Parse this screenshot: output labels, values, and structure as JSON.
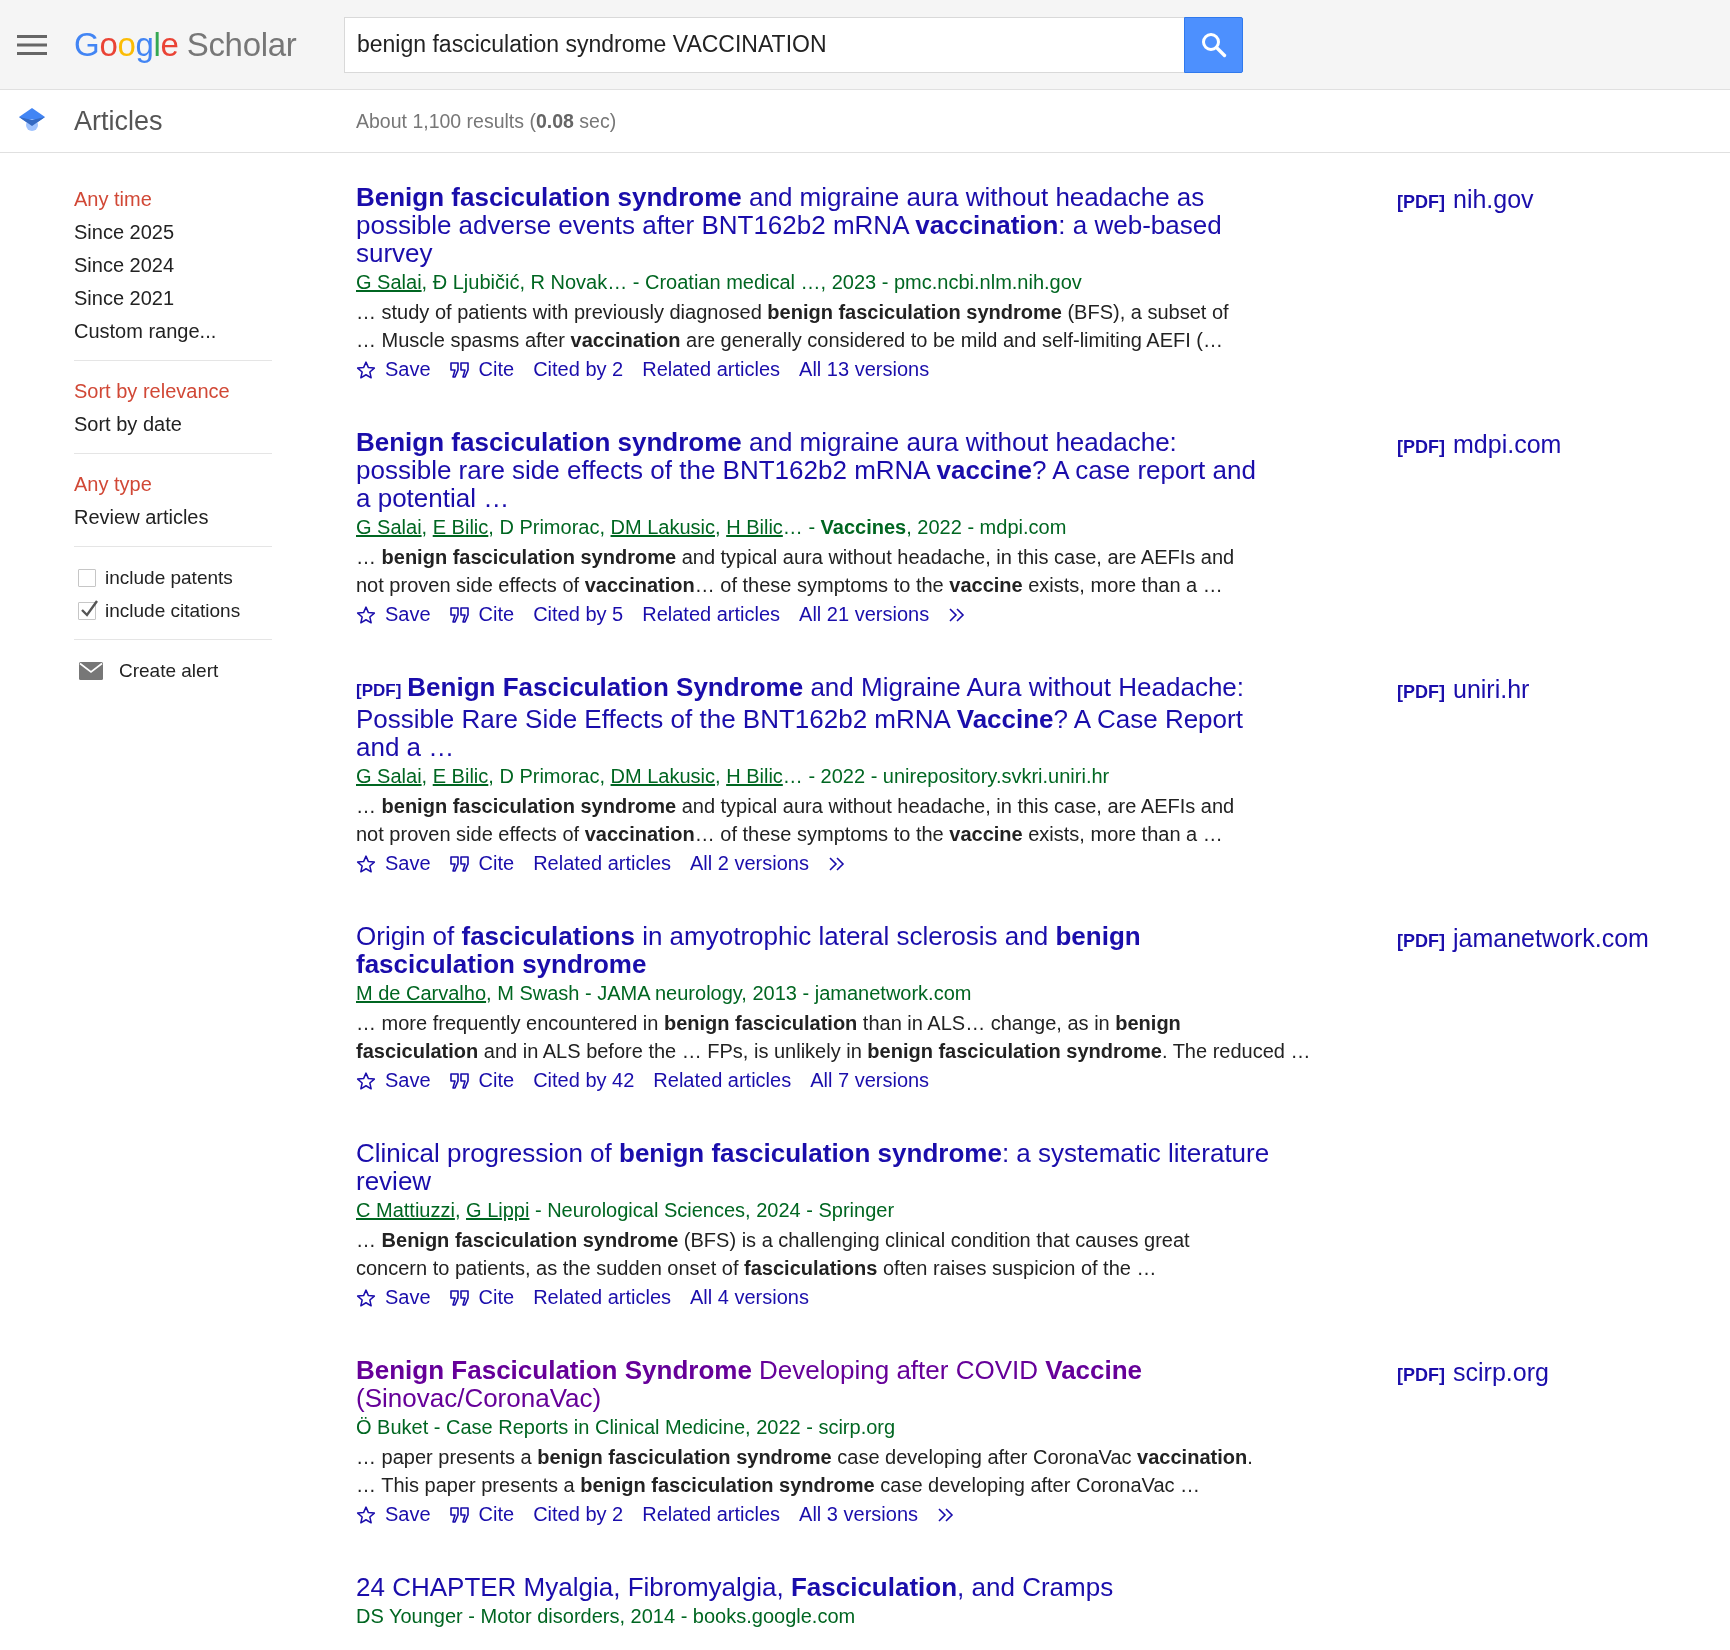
{
  "header": {
    "logo": {
      "brand": "Google",
      "product": "Scholar"
    },
    "search": {
      "value": "benign fasciculation syndrome VACCINATION"
    }
  },
  "subheader": {
    "section": "Articles",
    "stats": "About 1,100 results (**0.08** sec)"
  },
  "sidebar": {
    "time_filters": [
      {
        "label": "Any time",
        "selected": true
      },
      {
        "label": "Since 2025",
        "selected": false
      },
      {
        "label": "Since 2024",
        "selected": false
      },
      {
        "label": "Since 2021",
        "selected": false
      },
      {
        "label": "Custom range...",
        "selected": false
      }
    ],
    "sort_options": [
      {
        "label": "Sort by relevance",
        "selected": true
      },
      {
        "label": "Sort by date",
        "selected": false
      }
    ],
    "type_filters": [
      {
        "label": "Any type",
        "selected": true
      },
      {
        "label": "Review articles",
        "selected": false
      }
    ],
    "checkboxes": [
      {
        "label": "include patents",
        "checked": false
      },
      {
        "label": "include citations",
        "checked": true
      }
    ],
    "alert": "Create alert"
  },
  "results": [
    {
      "title": "**Benign fasciculation syndrome** and migraine aura without headache as possible adverse events after BNT162b2 mRNA **vaccination**: a web-based survey",
      "visited": false,
      "byline": [
        {
          "text": "G Salai",
          "linked": true
        },
        {
          "text": ", Đ Ljubičić, R Novak… - Croatian medical …, 2023 - pmc.ncbi.nlm.nih.gov",
          "linked": false
        }
      ],
      "snippet_lines": [
        "… study of patients with previously diagnosed **benign fasciculation syndrome** (BFS), a subset of",
        "… Muscle spasms after **vaccination** are generally considered to be mild and self-limiting AEFI (…"
      ],
      "actions": [
        {
          "kind": "save",
          "label": "Save"
        },
        {
          "kind": "cite",
          "label": "Cite"
        },
        {
          "kind": "link",
          "label": "Cited by 2"
        },
        {
          "kind": "link",
          "label": "Related articles"
        },
        {
          "kind": "link",
          "label": "All 13 versions"
        }
      ],
      "more": false,
      "side_link": {
        "tag": "[PDF]",
        "domain": "nih.gov"
      }
    },
    {
      "title": "**Benign fasciculation syndrome** and migraine aura without headache: possible rare side effects of the BNT162b2 mRNA **vaccine**? A case report and a potential …",
      "visited": false,
      "byline": [
        {
          "text": "G Salai",
          "linked": true
        },
        {
          "text": ", ",
          "linked": false
        },
        {
          "text": "E Bilic",
          "linked": true
        },
        {
          "text": ", D Primorac, ",
          "linked": false
        },
        {
          "text": "DM Lakusic",
          "linked": true
        },
        {
          "text": ", ",
          "linked": false
        },
        {
          "text": "H Bilic",
          "linked": true
        },
        {
          "text": "… - **Vaccines**, 2022 - mdpi.com",
          "linked": false
        }
      ],
      "snippet_lines": [
        "… **benign fasciculation syndrome** and typical aura without headache, in this case, are AEFIs and",
        "not proven side effects of **vaccination**… of these symptoms to the **vaccine** exists, more than a …"
      ],
      "actions": [
        {
          "kind": "save",
          "label": "Save"
        },
        {
          "kind": "cite",
          "label": "Cite"
        },
        {
          "kind": "link",
          "label": "Cited by 5"
        },
        {
          "kind": "link",
          "label": "Related articles"
        },
        {
          "kind": "link",
          "label": "All 21 versions"
        }
      ],
      "more": true,
      "side_link": {
        "tag": "[PDF]",
        "domain": "mdpi.com"
      }
    },
    {
      "pdf_tag": "[PDF]",
      "title": "**Benign Fasciculation Syndrome** and Migraine Aura without Headache: Possible Rare Side Effects of the BNT162b2 mRNA **Vaccine**? A Case Report and a …",
      "visited": false,
      "byline": [
        {
          "text": "G Salai",
          "linked": true
        },
        {
          "text": ", ",
          "linked": false
        },
        {
          "text": "E Bilic",
          "linked": true
        },
        {
          "text": ", D Primorac, ",
          "linked": false
        },
        {
          "text": "DM Lakusic",
          "linked": true
        },
        {
          "text": ", ",
          "linked": false
        },
        {
          "text": "H Bilic",
          "linked": true
        },
        {
          "text": "… - 2022 - unirepository.svkri.uniri.hr",
          "linked": false
        }
      ],
      "snippet_lines": [
        "… **benign fasciculation syndrome** and typical aura without headache, in this case, are AEFIs and",
        "not proven side effects of **vaccination**… of these symptoms to the **vaccine** exists, more than a …"
      ],
      "actions": [
        {
          "kind": "save",
          "label": "Save"
        },
        {
          "kind": "cite",
          "label": "Cite"
        },
        {
          "kind": "link",
          "label": "Related articles"
        },
        {
          "kind": "link",
          "label": "All 2 versions"
        }
      ],
      "more": true,
      "side_link": {
        "tag": "[PDF]",
        "domain": "uniri.hr"
      }
    },
    {
      "title": "Origin of **fasciculations** in amyotrophic lateral sclerosis and **benign fasciculation syndrome**",
      "visited": false,
      "byline": [
        {
          "text": "M de Carvalho",
          "linked": true
        },
        {
          "text": ", M Swash - JAMA neurology, 2013 - jamanetwork.com",
          "linked": false
        }
      ],
      "snippet_lines": [
        "… more frequently encountered in **benign fasciculation** than in ALS… change, as in **benign**",
        "**fasciculation** and in ALS before the … FPs, is unlikely in **benign fasciculation syndrome**. The reduced …"
      ],
      "actions": [
        {
          "kind": "save",
          "label": "Save"
        },
        {
          "kind": "cite",
          "label": "Cite"
        },
        {
          "kind": "link",
          "label": "Cited by 42"
        },
        {
          "kind": "link",
          "label": "Related articles"
        },
        {
          "kind": "link",
          "label": "All 7 versions"
        }
      ],
      "more": false,
      "side_link": {
        "tag": "[PDF]",
        "domain": "jamanetwork.com"
      }
    },
    {
      "title": "Clinical progression of **benign fasciculation syndrome**: a systematic literature review",
      "visited": false,
      "byline": [
        {
          "text": "C Mattiuzzi",
          "linked": true
        },
        {
          "text": ", ",
          "linked": false
        },
        {
          "text": "G Lippi",
          "linked": true
        },
        {
          "text": " - Neurological Sciences, 2024 - Springer",
          "linked": false
        }
      ],
      "snippet_lines": [
        "… **Benign fasciculation syndrome** (BFS) is a challenging clinical condition that causes great",
        "concern to patients, as the sudden onset of **fasciculations** often raises suspicion of the …"
      ],
      "actions": [
        {
          "kind": "save",
          "label": "Save"
        },
        {
          "kind": "cite",
          "label": "Cite"
        },
        {
          "kind": "link",
          "label": "Related articles"
        },
        {
          "kind": "link",
          "label": "All 4 versions"
        }
      ],
      "more": false
    },
    {
      "title": "**Benign Fasciculation Syndrome** Developing after COVID **Vaccine** (Sinovac/CoronaVac)",
      "visited": true,
      "byline": [
        {
          "text": "Ö Buket - Case Reports in Clinical Medicine, 2022 - scirp.org",
          "linked": false
        }
      ],
      "snippet_lines": [
        "… paper presents a **benign fasciculation syndrome** case developing after CoronaVac **vaccination**.",
        "… This paper presents a **benign fasciculation syndrome** case developing after CoronaVac …"
      ],
      "actions": [
        {
          "kind": "save",
          "label": "Save"
        },
        {
          "kind": "cite",
          "label": "Cite"
        },
        {
          "kind": "link",
          "label": "Cited by 2"
        },
        {
          "kind": "link",
          "label": "Related articles"
        },
        {
          "kind": "link",
          "label": "All 3 versions"
        }
      ],
      "more": true,
      "side_link": {
        "tag": "[PDF]",
        "domain": "scirp.org"
      }
    },
    {
      "title": "24 CHAPTER Myalgia, Fibromyalgia, **Fasciculation**, and Cramps",
      "visited": false,
      "byline": [
        {
          "text": "DS Younger - Motor disorders, 2014 - books.google.com",
          "linked": false
        }
      ]
    }
  ]
}
